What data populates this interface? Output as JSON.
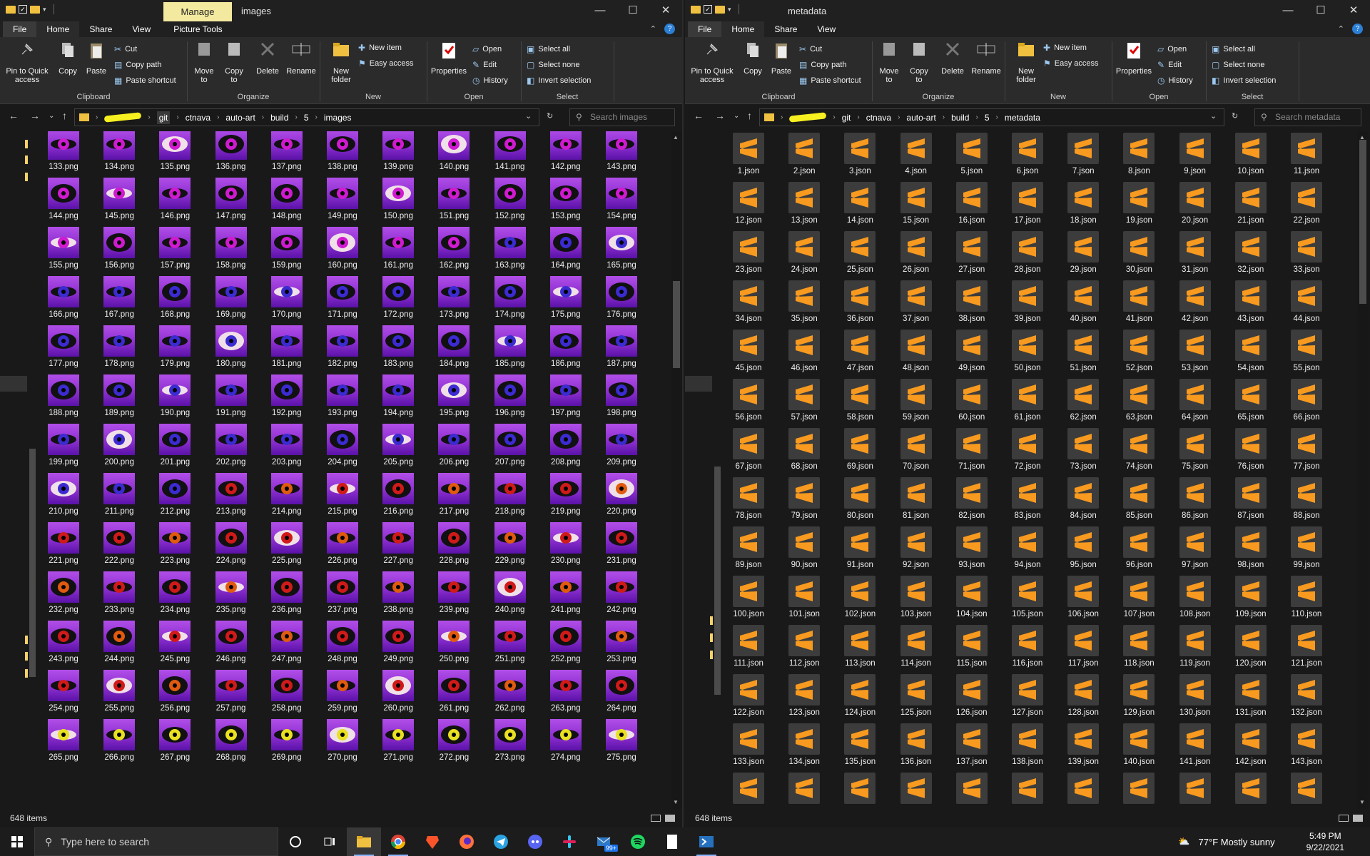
{
  "left": {
    "title": "images",
    "manage_tab": "Manage",
    "tabs": [
      "File",
      "Home",
      "Share",
      "View",
      "Picture Tools"
    ],
    "breadcrumb": [
      "git",
      "ctnava",
      "auto-art",
      "build",
      "5",
      "images"
    ],
    "search_placeholder": "Search images",
    "status": "648 items"
  },
  "right": {
    "title": "metadata",
    "tabs": [
      "File",
      "Home",
      "Share",
      "View"
    ],
    "breadcrumb": [
      "git",
      "ctnava",
      "auto-art",
      "build",
      "5",
      "metadata"
    ],
    "search_placeholder": "Search metadata",
    "status": "648 items"
  },
  "ribbon": {
    "pin": "Pin to Quick access",
    "copy": "Copy",
    "paste": "Paste",
    "cut": "Cut",
    "copy_path": "Copy path",
    "paste_shortcut": "Paste shortcut",
    "move_to": "Move to",
    "copy_to": "Copy to",
    "delete": "Delete",
    "rename": "Rename",
    "new_folder": "New folder",
    "new_item": "New item",
    "easy_access": "Easy access",
    "properties": "Properties",
    "open": "Open",
    "edit": "Edit",
    "history": "History",
    "select_all": "Select all",
    "select_none": "Select none",
    "invert_selection": "Invert selection",
    "groups": [
      "Clipboard",
      "Organize",
      "New",
      "Open",
      "Select"
    ]
  },
  "images_grid": {
    "first_index": 133,
    "last_index": 275,
    "extension": ".png",
    "columns": 11,
    "iris_palette": [
      "#d01ad0",
      "#3b2bd0",
      "#d01a1a",
      "#e05a10",
      "#e8e020"
    ]
  },
  "metadata_grid": {
    "first_index": 1,
    "last_index": 143,
    "extension": ".json",
    "columns": 11,
    "icon": "sublime-text-icon",
    "icon_color": "#f79a1f"
  },
  "taskbar": {
    "search_placeholder": "Type here to search",
    "badge": "99+",
    "weather": "77°F  Mostly sunny",
    "time": "5:49 PM",
    "date": "9/22/2021"
  }
}
